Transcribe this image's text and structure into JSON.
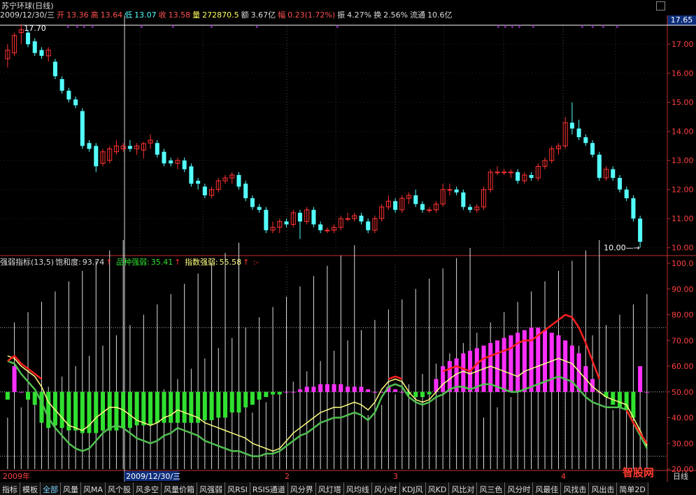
{
  "window": {
    "title": "苏宁环球(日线)"
  },
  "quote_bar": {
    "date": "2009/12/30/三",
    "open_label": "开",
    "open": "13.36",
    "high_label": "高",
    "high": "13.64",
    "low_label": "低",
    "low": "13.07",
    "close_label": "收",
    "close": "13.58",
    "volume_label": "量",
    "volume": "272870.5",
    "amount_label": "额",
    "amount": "3.67亿",
    "change_label": "幅",
    "change": "0.23(1.72%)",
    "amplitude_label": "振",
    "amplitude": "4.27%",
    "turnover_label": "换",
    "turnover": "2.56%",
    "float_label": "流通",
    "float": "10.6亿"
  },
  "price_panel": {
    "current_price_tag": "17.65",
    "high_marker": "17.70",
    "low_marker": "10.00",
    "y_ticks": [
      "17.00",
      "16.00",
      "15.00",
      "14.00",
      "13.00",
      "12.00",
      "11.00",
      "10.00"
    ]
  },
  "indicator_panel": {
    "name": "强弱指标(13,5)",
    "saturation_label": "饱和度:",
    "saturation": "93.74",
    "stock_strength_label": "品种强弱:",
    "stock_strength": "35.41",
    "index_strength_label": "指数强弱:",
    "index_strength": "55.58",
    "arrow": "↑",
    "extra": ":-",
    "y_ticks": [
      "100.0",
      "90.00",
      "80.00",
      "70.00",
      "60.00",
      "50.00",
      "40.00",
      "30.00",
      "20.00"
    ]
  },
  "time_axis": {
    "labels": [
      "2009年",
      "2009/12/30/三",
      "2",
      "3",
      "4"
    ],
    "end_label": "日线"
  },
  "tabs": [
    "指标",
    "模板",
    "全部",
    "风量",
    "风MA",
    "风个股",
    "风多空",
    "风量价箱",
    "风强弱",
    "风RSI",
    "RSIS通道",
    "风分界",
    "风灯塔",
    "风均线",
    "风小时",
    "KDJ风",
    "风KD",
    "风比对",
    "风三色",
    "风分时",
    "风最佳",
    "风找击",
    "风出击",
    "简单2D"
  ],
  "logo": "智股网",
  "colors": {
    "up": "#ff3232",
    "down": "#54ffff",
    "strong": "#ff30ff",
    "weak": "#30e030",
    "line_yellow": "#ffff80",
    "line_red": "#ff2020",
    "line_green": "#50c050",
    "axis": "#c03030"
  },
  "chart_data": [
    {
      "type": "candlestick",
      "title": "苏宁环球(日线)",
      "ylim": [
        9.8,
        17.8
      ],
      "candles": [
        [
          16.5,
          16.8,
          16.2,
          17.0
        ],
        [
          16.7,
          17.3,
          16.6,
          17.4
        ],
        [
          17.4,
          17.5,
          17.0,
          17.7
        ],
        [
          17.4,
          17.0,
          16.9,
          17.5
        ],
        [
          17.1,
          16.7,
          16.6,
          17.2
        ],
        [
          16.8,
          16.6,
          16.5,
          16.9
        ],
        [
          16.6,
          16.8,
          16.4,
          16.9
        ],
        [
          16.4,
          15.9,
          15.8,
          16.5
        ],
        [
          15.8,
          15.4,
          15.3,
          15.9
        ],
        [
          15.4,
          15.1,
          15.0,
          15.5
        ],
        [
          15.1,
          14.9,
          14.8,
          15.2
        ],
        [
          14.7,
          13.5,
          13.4,
          14.8
        ],
        [
          13.6,
          13.4,
          13.3,
          13.7
        ],
        [
          13.5,
          12.8,
          12.6,
          13.6
        ],
        [
          12.9,
          13.3,
          12.8,
          13.4
        ],
        [
          13.0,
          13.4,
          12.9,
          13.5
        ],
        [
          13.3,
          13.5,
          13.2,
          13.7
        ],
        [
          13.4,
          13.5,
          13.3,
          13.6
        ],
        [
          13.5,
          13.4,
          13.3,
          13.7
        ],
        [
          13.4,
          13.5,
          13.2,
          13.6
        ],
        [
          13.36,
          13.58,
          13.07,
          13.64
        ],
        [
          13.6,
          13.7,
          13.4,
          13.9
        ],
        [
          13.6,
          13.2,
          13.1,
          13.7
        ],
        [
          13.3,
          12.9,
          12.8,
          13.4
        ],
        [
          13.0,
          12.9,
          12.8,
          13.1
        ],
        [
          12.9,
          13.0,
          12.7,
          13.1
        ],
        [
          13.0,
          12.7,
          12.6,
          13.1
        ],
        [
          12.8,
          12.2,
          12.1,
          12.9
        ],
        [
          12.3,
          12.2,
          12.0,
          12.4
        ],
        [
          12.1,
          11.8,
          11.7,
          12.2
        ],
        [
          11.8,
          12.0,
          11.7,
          12.1
        ],
        [
          12.0,
          12.3,
          11.9,
          12.4
        ],
        [
          12.3,
          12.4,
          12.2,
          12.5
        ],
        [
          12.4,
          12.5,
          12.2,
          12.6
        ],
        [
          12.5,
          12.1,
          12.0,
          12.6
        ],
        [
          12.2,
          11.7,
          11.6,
          12.3
        ],
        [
          11.7,
          11.4,
          11.3,
          11.8
        ],
        [
          11.4,
          11.3,
          11.2,
          11.5
        ],
        [
          11.3,
          10.6,
          10.5,
          11.4
        ],
        [
          10.6,
          10.7,
          10.5,
          10.9
        ],
        [
          10.7,
          10.9,
          10.5,
          11.0
        ],
        [
          10.9,
          10.8,
          10.7,
          11.0
        ],
        [
          10.8,
          11.2,
          10.7,
          11.3
        ],
        [
          11.2,
          10.9,
          10.3,
          11.3
        ],
        [
          10.9,
          11.3,
          10.8,
          11.4
        ],
        [
          11.3,
          10.8,
          10.7,
          11.4
        ],
        [
          10.8,
          10.6,
          10.5,
          10.9
        ],
        [
          10.6,
          10.6,
          10.5,
          10.7
        ],
        [
          10.6,
          10.7,
          10.5,
          10.8
        ],
        [
          10.7,
          11.0,
          10.6,
          11.1
        ],
        [
          11.0,
          11.0,
          10.9,
          11.2
        ],
        [
          11.0,
          11.1,
          10.9,
          11.2
        ],
        [
          11.1,
          10.9,
          10.8,
          11.2
        ],
        [
          10.9,
          10.6,
          10.5,
          11.0
        ],
        [
          10.6,
          11.0,
          10.5,
          11.1
        ],
        [
          11.0,
          11.4,
          10.9,
          11.5
        ],
        [
          11.4,
          11.6,
          11.3,
          11.8
        ],
        [
          11.6,
          11.3,
          11.2,
          11.7
        ],
        [
          11.3,
          11.7,
          11.2,
          11.8
        ],
        [
          11.7,
          11.8,
          11.5,
          11.9
        ],
        [
          11.8,
          11.5,
          11.4,
          12.0
        ],
        [
          11.5,
          11.3,
          11.2,
          11.6
        ],
        [
          11.3,
          11.3,
          11.2,
          11.4
        ],
        [
          11.3,
          11.5,
          11.2,
          11.6
        ],
        [
          11.5,
          12.0,
          11.4,
          12.2
        ],
        [
          12.0,
          12.0,
          11.8,
          12.2
        ],
        [
          12.0,
          11.9,
          11.8,
          12.1
        ],
        [
          11.9,
          11.4,
          11.3,
          12.0
        ],
        [
          11.4,
          11.3,
          11.2,
          11.5
        ],
        [
          11.3,
          11.4,
          11.2,
          11.5
        ],
        [
          11.4,
          12.0,
          11.3,
          12.1
        ],
        [
          12.0,
          12.6,
          11.9,
          12.7
        ],
        [
          12.6,
          12.6,
          12.5,
          12.8
        ],
        [
          12.6,
          12.6,
          12.5,
          12.7
        ],
        [
          12.6,
          12.6,
          12.4,
          12.7
        ],
        [
          12.6,
          12.3,
          12.2,
          12.7
        ],
        [
          12.3,
          12.5,
          12.2,
          12.6
        ],
        [
          12.5,
          12.4,
          12.3,
          12.6
        ],
        [
          12.4,
          12.8,
          12.3,
          12.9
        ],
        [
          12.8,
          13.0,
          12.7,
          13.1
        ],
        [
          13.0,
          13.4,
          12.9,
          13.5
        ],
        [
          13.4,
          13.5,
          13.2,
          13.6
        ],
        [
          13.5,
          14.3,
          13.4,
          14.5
        ],
        [
          14.3,
          14.1,
          13.9,
          15.0
        ],
        [
          14.1,
          13.8,
          13.7,
          14.4
        ],
        [
          13.8,
          13.6,
          13.5,
          13.9
        ],
        [
          13.6,
          13.2,
          13.1,
          13.7
        ],
        [
          13.2,
          12.4,
          12.3,
          13.3
        ],
        [
          12.4,
          12.7,
          12.3,
          12.8
        ],
        [
          12.7,
          12.4,
          12.3,
          12.8
        ],
        [
          12.4,
          12.0,
          11.9,
          12.5
        ],
        [
          12.0,
          11.7,
          11.6,
          12.1
        ],
        [
          11.7,
          11.0,
          10.9,
          11.8
        ],
        [
          11.0,
          10.2,
          10.0,
          11.1
        ]
      ]
    },
    {
      "type": "line",
      "title": "强弱指标(13,5)",
      "ylim": [
        20,
        100
      ],
      "series": [
        {
          "name": "饱和度",
          "values": [
            62,
            64,
            61,
            59,
            57,
            55,
            52,
            48,
            45,
            43,
            40,
            38,
            39,
            41,
            42,
            44,
            43,
            42,
            40,
            39,
            37,
            36,
            38,
            40,
            41,
            42,
            41,
            40,
            39,
            37,
            36,
            36,
            35,
            35,
            34,
            33,
            31,
            30,
            29,
            28,
            30,
            33,
            36,
            38,
            41,
            43,
            44,
            45,
            46,
            47,
            48,
            49,
            47,
            45,
            48,
            52,
            55,
            56,
            55,
            52,
            49,
            48,
            49,
            54,
            58,
            59,
            60,
            59,
            58,
            61,
            63,
            64,
            65,
            66,
            67,
            69,
            70,
            70,
            72,
            74,
            76,
            78,
            80,
            79,
            75,
            69,
            62,
            55,
            49,
            47,
            45,
            43,
            38,
            34,
            30
          ]
        },
        {
          "name": "品种强弱",
          "values": [
            64,
            63,
            60,
            58,
            56,
            52,
            46,
            43,
            40,
            37,
            36,
            35,
            37,
            40,
            42,
            44,
            44,
            43,
            41,
            39,
            38,
            37,
            38,
            40,
            41,
            43,
            42,
            41,
            40,
            38,
            37,
            36,
            35,
            34,
            33,
            32,
            30,
            29,
            28,
            27,
            28,
            31,
            34,
            36,
            38,
            40,
            42,
            43,
            44,
            44,
            45,
            46,
            45,
            43,
            46,
            51,
            54,
            55,
            54,
            50,
            47,
            46,
            47,
            50,
            53,
            55,
            57,
            58,
            57,
            58,
            59,
            60,
            59,
            58,
            57,
            56,
            58,
            59,
            60,
            61,
            62,
            63,
            62,
            61,
            58,
            55,
            52,
            50,
            48,
            47,
            46,
            45,
            40,
            35,
            29
          ]
        },
        {
          "name": "指数强弱",
          "values": [
            62,
            61,
            57,
            54,
            51,
            46,
            40,
            36,
            33,
            30,
            28,
            27,
            28,
            31,
            34,
            36,
            37,
            36,
            34,
            32,
            31,
            30,
            31,
            33,
            34,
            36,
            35,
            34,
            33,
            31,
            30,
            29,
            28,
            27,
            27,
            26,
            25,
            25,
            26,
            26,
            27,
            29,
            31,
            33,
            34,
            36,
            38,
            39,
            40,
            40,
            41,
            42,
            41,
            39,
            42,
            48,
            52,
            53,
            52,
            48,
            46,
            45,
            46,
            48,
            49,
            51,
            52,
            52,
            51,
            52,
            53,
            53,
            52,
            51,
            50,
            50,
            51,
            52,
            53,
            54,
            55,
            56,
            55,
            54,
            51,
            48,
            46,
            45,
            44,
            44,
            44,
            43,
            38,
            33,
            28
          ]
        },
        {
          "name": "柱",
          "values": [
            47,
            60,
            50,
            47,
            45,
            38,
            36,
            37,
            36,
            35,
            35,
            34,
            34,
            34,
            35,
            35,
            35,
            36,
            36,
            37,
            37,
            37,
            38,
            38,
            38,
            38,
            38,
            38,
            38,
            39,
            39,
            40,
            40,
            42,
            42,
            44,
            45,
            47,
            48,
            49,
            49,
            50,
            50,
            51,
            52,
            52,
            53,
            53,
            53,
            53,
            52,
            52,
            52,
            51,
            50,
            50,
            52,
            51,
            50,
            49,
            48,
            48,
            49,
            55,
            60,
            62,
            63,
            65,
            66,
            67,
            68,
            69,
            70,
            71,
            72,
            73,
            74,
            75,
            75,
            74,
            73,
            72,
            70,
            68,
            65,
            60,
            55,
            50,
            48,
            45,
            44,
            43,
            40,
            60,
            50
          ]
        }
      ]
    }
  ]
}
